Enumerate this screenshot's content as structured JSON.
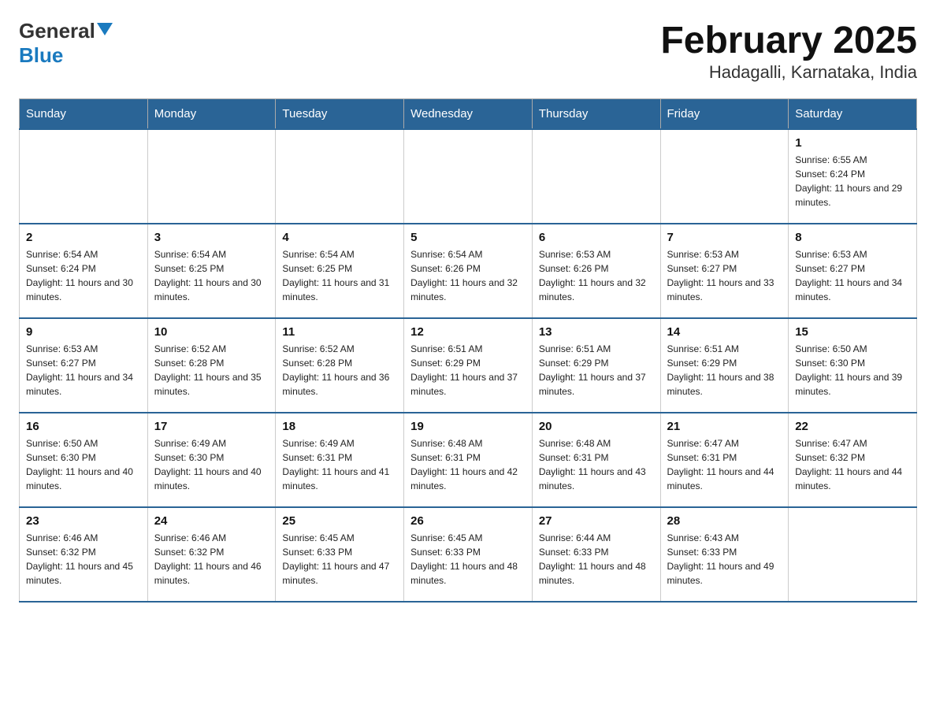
{
  "logo": {
    "line1": "General",
    "line2": "Blue"
  },
  "title": "February 2025",
  "subtitle": "Hadagalli, Karnataka, India",
  "days_of_week": [
    "Sunday",
    "Monday",
    "Tuesday",
    "Wednesday",
    "Thursday",
    "Friday",
    "Saturday"
  ],
  "weeks": [
    [
      {
        "day": "",
        "info": ""
      },
      {
        "day": "",
        "info": ""
      },
      {
        "day": "",
        "info": ""
      },
      {
        "day": "",
        "info": ""
      },
      {
        "day": "",
        "info": ""
      },
      {
        "day": "",
        "info": ""
      },
      {
        "day": "1",
        "info": "Sunrise: 6:55 AM\nSunset: 6:24 PM\nDaylight: 11 hours and 29 minutes."
      }
    ],
    [
      {
        "day": "2",
        "info": "Sunrise: 6:54 AM\nSunset: 6:24 PM\nDaylight: 11 hours and 30 minutes."
      },
      {
        "day": "3",
        "info": "Sunrise: 6:54 AM\nSunset: 6:25 PM\nDaylight: 11 hours and 30 minutes."
      },
      {
        "day": "4",
        "info": "Sunrise: 6:54 AM\nSunset: 6:25 PM\nDaylight: 11 hours and 31 minutes."
      },
      {
        "day": "5",
        "info": "Sunrise: 6:54 AM\nSunset: 6:26 PM\nDaylight: 11 hours and 32 minutes."
      },
      {
        "day": "6",
        "info": "Sunrise: 6:53 AM\nSunset: 6:26 PM\nDaylight: 11 hours and 32 minutes."
      },
      {
        "day": "7",
        "info": "Sunrise: 6:53 AM\nSunset: 6:27 PM\nDaylight: 11 hours and 33 minutes."
      },
      {
        "day": "8",
        "info": "Sunrise: 6:53 AM\nSunset: 6:27 PM\nDaylight: 11 hours and 34 minutes."
      }
    ],
    [
      {
        "day": "9",
        "info": "Sunrise: 6:53 AM\nSunset: 6:27 PM\nDaylight: 11 hours and 34 minutes."
      },
      {
        "day": "10",
        "info": "Sunrise: 6:52 AM\nSunset: 6:28 PM\nDaylight: 11 hours and 35 minutes."
      },
      {
        "day": "11",
        "info": "Sunrise: 6:52 AM\nSunset: 6:28 PM\nDaylight: 11 hours and 36 minutes."
      },
      {
        "day": "12",
        "info": "Sunrise: 6:51 AM\nSunset: 6:29 PM\nDaylight: 11 hours and 37 minutes."
      },
      {
        "day": "13",
        "info": "Sunrise: 6:51 AM\nSunset: 6:29 PM\nDaylight: 11 hours and 37 minutes."
      },
      {
        "day": "14",
        "info": "Sunrise: 6:51 AM\nSunset: 6:29 PM\nDaylight: 11 hours and 38 minutes."
      },
      {
        "day": "15",
        "info": "Sunrise: 6:50 AM\nSunset: 6:30 PM\nDaylight: 11 hours and 39 minutes."
      }
    ],
    [
      {
        "day": "16",
        "info": "Sunrise: 6:50 AM\nSunset: 6:30 PM\nDaylight: 11 hours and 40 minutes."
      },
      {
        "day": "17",
        "info": "Sunrise: 6:49 AM\nSunset: 6:30 PM\nDaylight: 11 hours and 40 minutes."
      },
      {
        "day": "18",
        "info": "Sunrise: 6:49 AM\nSunset: 6:31 PM\nDaylight: 11 hours and 41 minutes."
      },
      {
        "day": "19",
        "info": "Sunrise: 6:48 AM\nSunset: 6:31 PM\nDaylight: 11 hours and 42 minutes."
      },
      {
        "day": "20",
        "info": "Sunrise: 6:48 AM\nSunset: 6:31 PM\nDaylight: 11 hours and 43 minutes."
      },
      {
        "day": "21",
        "info": "Sunrise: 6:47 AM\nSunset: 6:31 PM\nDaylight: 11 hours and 44 minutes."
      },
      {
        "day": "22",
        "info": "Sunrise: 6:47 AM\nSunset: 6:32 PM\nDaylight: 11 hours and 44 minutes."
      }
    ],
    [
      {
        "day": "23",
        "info": "Sunrise: 6:46 AM\nSunset: 6:32 PM\nDaylight: 11 hours and 45 minutes."
      },
      {
        "day": "24",
        "info": "Sunrise: 6:46 AM\nSunset: 6:32 PM\nDaylight: 11 hours and 46 minutes."
      },
      {
        "day": "25",
        "info": "Sunrise: 6:45 AM\nSunset: 6:33 PM\nDaylight: 11 hours and 47 minutes."
      },
      {
        "day": "26",
        "info": "Sunrise: 6:45 AM\nSunset: 6:33 PM\nDaylight: 11 hours and 48 minutes."
      },
      {
        "day": "27",
        "info": "Sunrise: 6:44 AM\nSunset: 6:33 PM\nDaylight: 11 hours and 48 minutes."
      },
      {
        "day": "28",
        "info": "Sunrise: 6:43 AM\nSunset: 6:33 PM\nDaylight: 11 hours and 49 minutes."
      },
      {
        "day": "",
        "info": ""
      }
    ]
  ]
}
